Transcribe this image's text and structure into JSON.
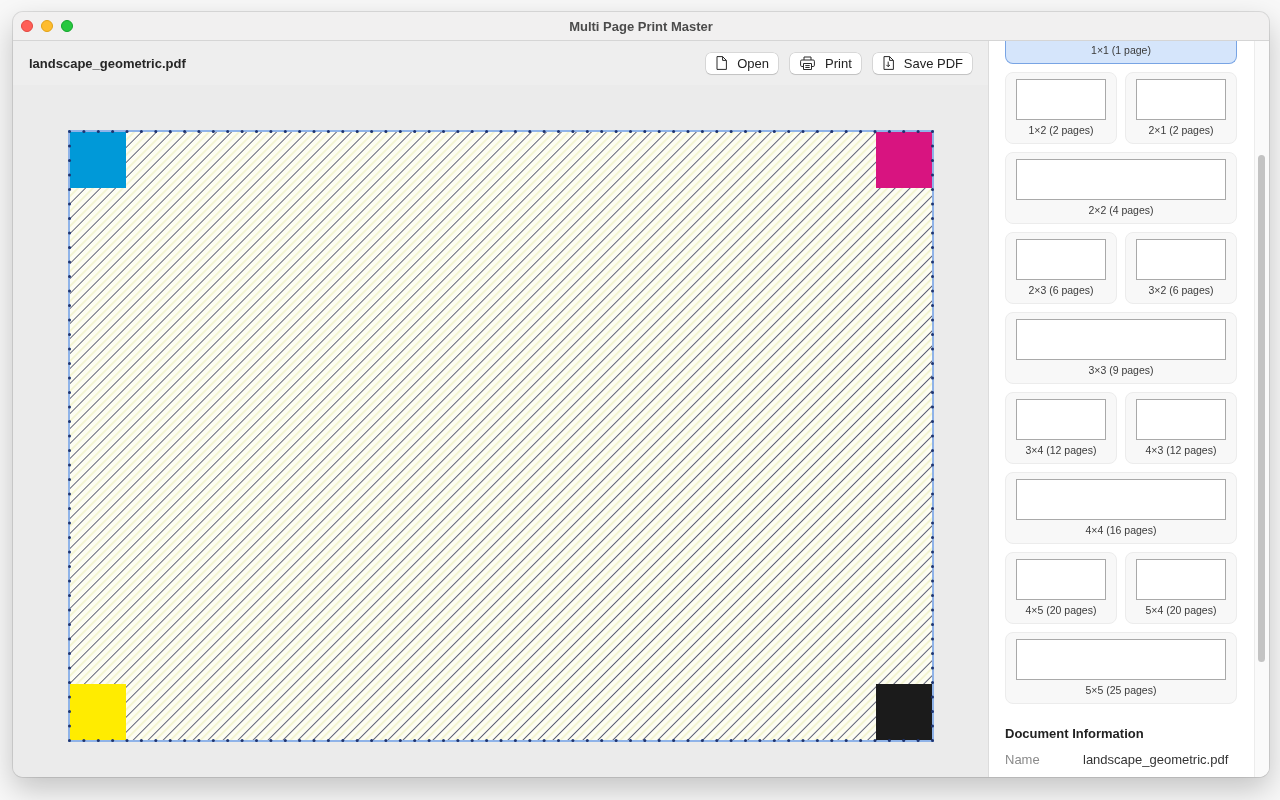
{
  "window": {
    "title": "Multi Page Print Master"
  },
  "toolbar": {
    "file_name": "landscape_geometric.pdf",
    "buttons": [
      {
        "kind": "open",
        "label": "Open"
      },
      {
        "kind": "print",
        "label": "Print"
      },
      {
        "kind": "export",
        "label": "Save PDF"
      }
    ]
  },
  "layouts": [
    {
      "kind": "full",
      "label": "1×1 (1 page)",
      "selected": true
    },
    {
      "kind": "half",
      "label": "1×2 (2 pages)",
      "selected": false
    },
    {
      "kind": "half",
      "label": "2×1 (2 pages)",
      "selected": false
    },
    {
      "kind": "full",
      "label": "2×2 (4 pages)",
      "selected": false
    },
    {
      "kind": "half",
      "label": "2×3 (6 pages)",
      "selected": false
    },
    {
      "kind": "half",
      "label": "3×2 (6 pages)",
      "selected": false
    },
    {
      "kind": "full",
      "label": "3×3 (9 pages)",
      "selected": false
    },
    {
      "kind": "half",
      "label": "3×4 (12 pages)",
      "selected": false
    },
    {
      "kind": "half",
      "label": "4×3 (12 pages)",
      "selected": false
    },
    {
      "kind": "full",
      "label": "4×4 (16 pages)",
      "selected": false
    },
    {
      "kind": "half",
      "label": "4×5 (20 pages)",
      "selected": false
    },
    {
      "kind": "half",
      "label": "5×4 (20 pages)",
      "selected": false
    },
    {
      "kind": "full",
      "label": "5×5 (25 pages)",
      "selected": false
    }
  ],
  "document_information": {
    "title": "Document Information",
    "fields": [
      {
        "label": "Name",
        "value": "landscape_geometric.pdf"
      }
    ]
  }
}
